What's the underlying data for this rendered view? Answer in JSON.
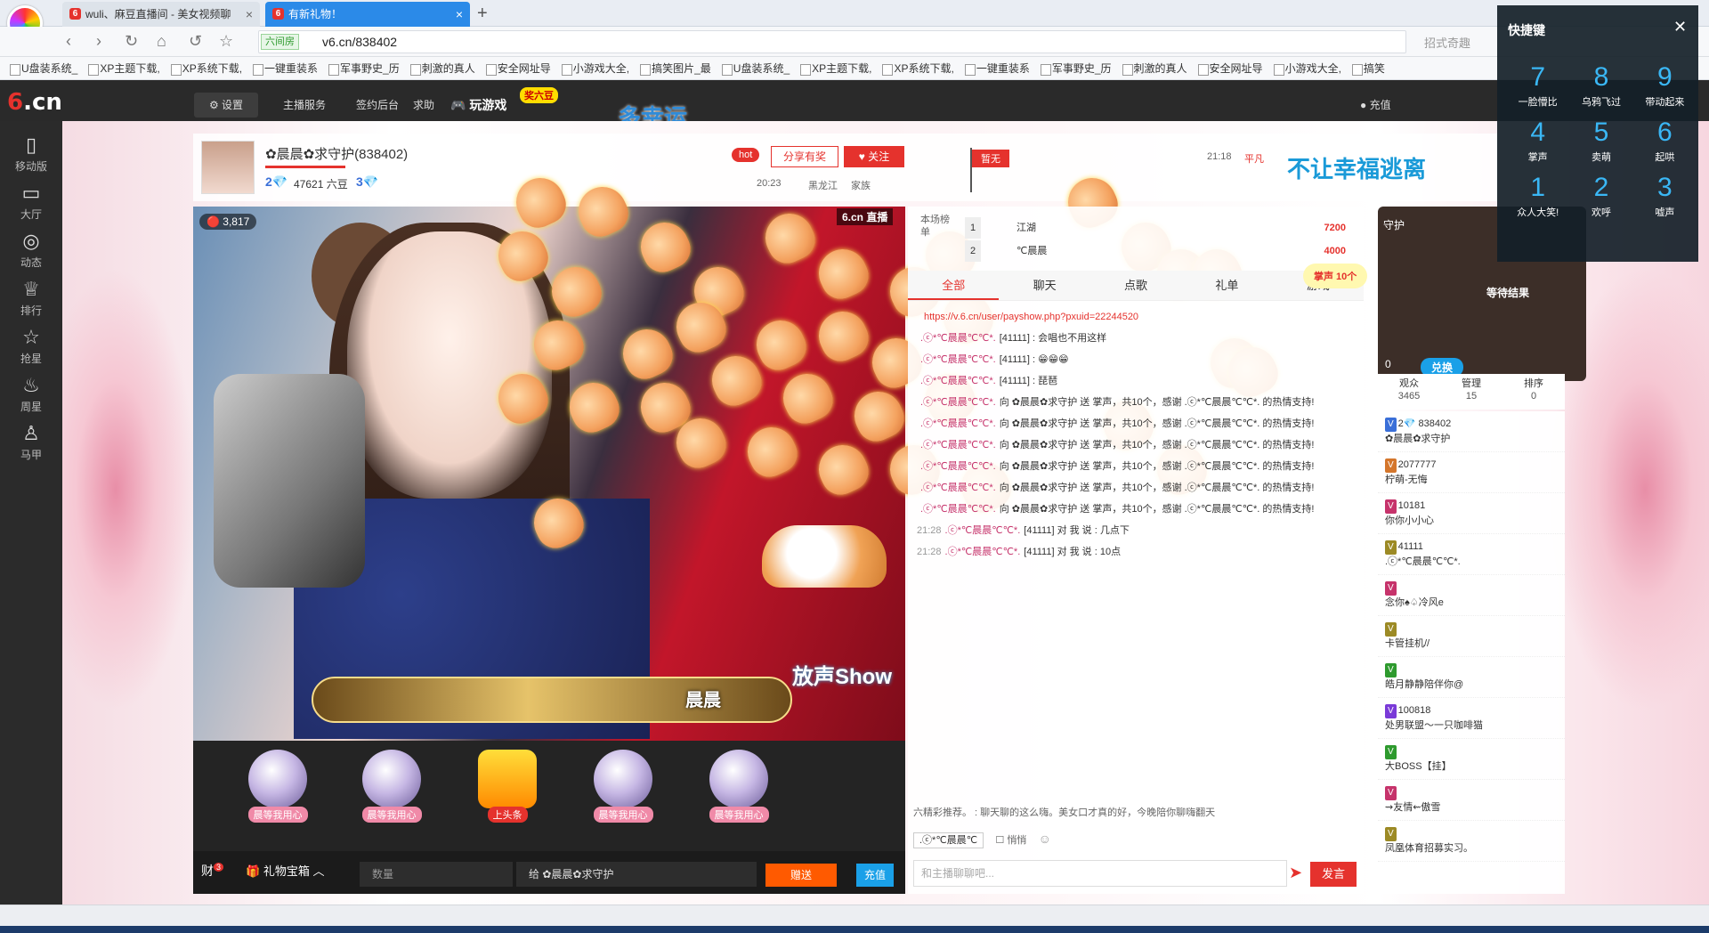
{
  "browser": {
    "tabs": [
      {
        "label": "wuli、麻豆直播间 - 美女视频聊"
      },
      {
        "label": "有新礼物！"
      }
    ],
    "site_badge": "六间房",
    "url": "v6.cn/838402",
    "search_hint": "招式奇趣",
    "bookmarks": [
      "U盘装系统_",
      "XP主题下载,",
      "XP系统下载,",
      "一键重装系",
      "军事野史_历",
      "刺激的真人",
      "安全网址导",
      "小游戏大全,",
      "搞笑图片_最",
      "U盘装系统_",
      "XP主题下载,",
      "XP系统下载,",
      "一键重装系",
      "军事野史_历",
      "刺激的真人",
      "安全网址导",
      "小游戏大全,",
      "搞笑"
    ]
  },
  "site": {
    "logo_main": "6",
    "logo_tail": ".cn",
    "settings": "设置",
    "host_service": "主播服务",
    "sign_backend": "签约后台",
    "help": "求助",
    "play_game": "玩游戏",
    "game_badge": "奖六豆",
    "luck": "多幸运",
    "recharge": "充值"
  },
  "leftnav": [
    {
      "icon": "mobile-icon",
      "label": "移动版"
    },
    {
      "icon": "tv-icon",
      "label": "大厅"
    },
    {
      "icon": "compass-icon",
      "label": "动态"
    },
    {
      "icon": "crown-icon",
      "label": "排行"
    },
    {
      "icon": "star-icon",
      "label": "抢星"
    },
    {
      "icon": "cup-icon",
      "label": "周星"
    },
    {
      "icon": "shirt-icon",
      "label": "马甲"
    }
  ],
  "anchor": {
    "name": "✿晨晨✿求守护(838402)",
    "level": "2💎",
    "beans": "47621 六豆",
    "wealth": "3💎",
    "hot": "hot",
    "share": "分享有奖",
    "follow": "关注",
    "live_time": "20:23",
    "city": "黑龙江",
    "family": "家族",
    "flag": "暂无",
    "contest_time": "21:18",
    "contest_level": "平凡",
    "banner": "不让幸福逃离"
  },
  "video": {
    "viewers": "3,817",
    "logo": "6.cn 直播",
    "stage_name": "晨晨"
  },
  "gifts": [
    {
      "label": "晨等我用心"
    },
    {
      "label": "晨等我用心"
    },
    {
      "label": "上头条"
    },
    {
      "label": "晨等我用心"
    },
    {
      "label": "晨等我用心"
    }
  ],
  "giftbar": {
    "money": "财",
    "money_count": "3",
    "giftbox": "礼物宝箱",
    "qty_placeholder": "数量",
    "to": "给  ✿晨晨✿求守护",
    "send": "赠送",
    "charge": "充值"
  },
  "chat": {
    "rank_header": "本场榜单",
    "ranks": [
      {
        "n": "1",
        "name": "江湖",
        "value": "7200"
      },
      {
        "n": "2",
        "name": "℃晨晨",
        "value": "4000"
      }
    ],
    "tabs": [
      "全部",
      "聊天",
      "点歌",
      "礼单",
      "游戏"
    ],
    "messages": [
      {
        "t": "",
        "u": "",
        "text": "https://v.6.cn/user/payshow.php?pxuid=22244520",
        "link": true
      },
      {
        "t": "",
        "u": ".ⓒ*℃晨晨℃℃*.",
        "text": "[41111] : 会唱也不用这样"
      },
      {
        "t": "",
        "u": ".ⓒ*℃晨晨℃℃*.",
        "text": "[41111] : 😁😁😁"
      },
      {
        "t": "",
        "u": ".ⓒ*℃晨晨℃℃*.",
        "text": "[41111] : 琵琶"
      },
      {
        "t": "",
        "u": ".ⓒ*℃晨晨℃℃*.",
        "text": "向 ✿晨晨✿求守护 送 掌声，共10个，感谢 .ⓒ*℃晨晨℃℃*. 的热情支持!"
      },
      {
        "t": "",
        "u": ".ⓒ*℃晨晨℃℃*.",
        "text": "向 ✿晨晨✿求守护 送 掌声，共10个，感谢 .ⓒ*℃晨晨℃℃*. 的热情支持!"
      },
      {
        "t": "",
        "u": ".ⓒ*℃晨晨℃℃*.",
        "text": "向 ✿晨晨✿求守护 送 掌声，共10个，感谢 .ⓒ*℃晨晨℃℃*. 的热情支持!"
      },
      {
        "t": "",
        "u": ".ⓒ*℃晨晨℃℃*.",
        "text": "向 ✿晨晨✿求守护 送 掌声，共10个，感谢 .ⓒ*℃晨晨℃℃*. 的热情支持!"
      },
      {
        "t": "",
        "u": ".ⓒ*℃晨晨℃℃*.",
        "text": "向 ✿晨晨✿求守护 送 掌声，共10个，感谢 .ⓒ*℃晨晨℃℃*. 的热情支持!"
      },
      {
        "t": "",
        "u": ".ⓒ*℃晨晨℃℃*.",
        "text": "向 ✿晨晨✿求守护 送 掌声，共10个，感谢 .ⓒ*℃晨晨℃℃*. 的热情支持!"
      },
      {
        "t": "21:28",
        "u": ".ⓒ*℃晨晨℃℃*.",
        "text": "[41111] 对 我 说 : 几点下"
      },
      {
        "t": "21:28",
        "u": ".ⓒ*℃晨晨℃℃*.",
        "text": "[41111] 对 我 说 : 10点"
      }
    ],
    "promo": "六精彩推荐。 : 聊天聊的这么嗨。美女口才真的好，今晚陪你聊嗨翻天",
    "target": ".ⓒ*℃晨晨℃",
    "whisper": "悄悄",
    "input_placeholder": "和主播聊聊吧...",
    "send": "发言"
  },
  "guard": {
    "title": "守护",
    "clap_notice": "掌声 10个",
    "wait": "等待结果",
    "coins": "0",
    "exchange": "兑换"
  },
  "stats": [
    {
      "label": "观众",
      "count": "3465"
    },
    {
      "label": "管理",
      "count": "15"
    },
    {
      "label": "排序",
      "count": "0"
    }
  ],
  "users": [
    {
      "id": "2💎 838402",
      "name": "✿晨晨✿求守护",
      "color": "#3a6fd8"
    },
    {
      "id": "2077777",
      "name": "柠萌-无悔",
      "color": "#d4762c"
    },
    {
      "id": "10181",
      "name": "你你小小心",
      "color": "#c6336b"
    },
    {
      "id": "41111",
      "name": ".ⓒ*℃晨晨℃℃*.",
      "color": "#9c8a25"
    },
    {
      "id": "",
      "name": "念你♠♤冷风e",
      "color": "#c6336b"
    },
    {
      "id": "",
      "name": "卡管挂机//",
      "color": "#9c8a25"
    },
    {
      "id": "",
      "name": "皓月静静陪伴你@",
      "color": "#2e9a2e"
    },
    {
      "id": "100818",
      "name": "处男联盟～一只咖啡猫",
      "color": "#7a3ad8"
    },
    {
      "id": "",
      "name": "大BOSS【挂】",
      "color": "#2e9a2e"
    },
    {
      "id": "",
      "name": "⇝友情⇜傲雪",
      "color": "#c6336b"
    },
    {
      "id": "",
      "name": "凤凰体育招募实习。",
      "color": "#9c8a25"
    }
  ],
  "hotkeys": {
    "title": "快捷键",
    "keys": [
      {
        "k": "7",
        "d": "一脸懵比"
      },
      {
        "k": "8",
        "d": "乌鸦飞过"
      },
      {
        "k": "9",
        "d": "带动起来"
      },
      {
        "k": "4",
        "d": "掌声"
      },
      {
        "k": "5",
        "d": "卖萌"
      },
      {
        "k": "6",
        "d": "起哄"
      },
      {
        "k": "1",
        "d": "众人大笑!"
      },
      {
        "k": "2",
        "d": "欢呼"
      },
      {
        "k": "3",
        "d": "嘘声"
      }
    ]
  }
}
